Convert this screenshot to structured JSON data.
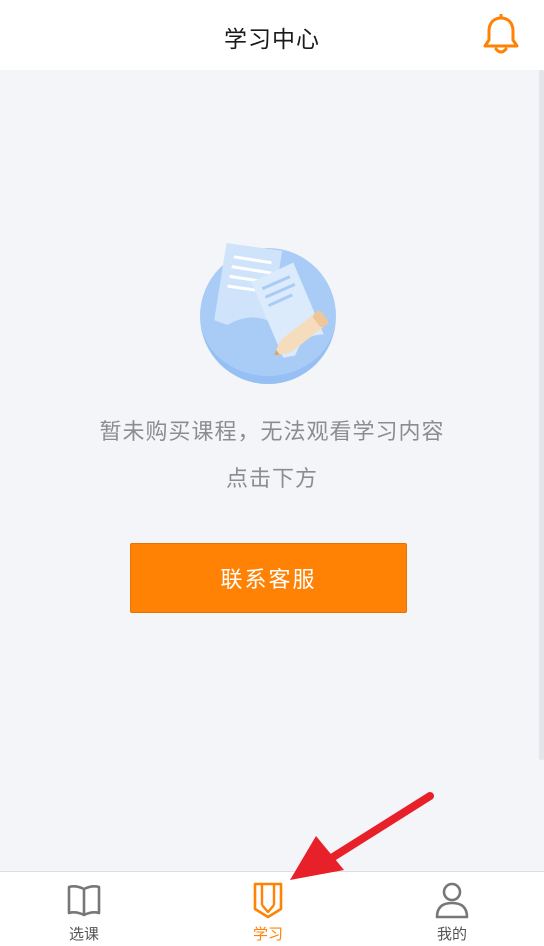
{
  "header": {
    "title": "学习中心",
    "bell_icon": "bell-icon"
  },
  "empty_state": {
    "illustration_icon": "documents-pencil-illustration",
    "line1": "暂未购买课程，无法观看学习内容",
    "line2": "点击下方",
    "contact_button_label": "联系客服"
  },
  "tabbar": {
    "active_tab": "学习",
    "tabs": [
      {
        "label": "选课",
        "icon": "book-icon"
      },
      {
        "label": "学习",
        "icon": "pencil-book-icon"
      },
      {
        "label": "我的",
        "icon": "user-icon"
      }
    ]
  },
  "colors": {
    "accent": "#ff8205",
    "background": "#f4f5f9",
    "annotation_arrow": "#e8202a"
  }
}
